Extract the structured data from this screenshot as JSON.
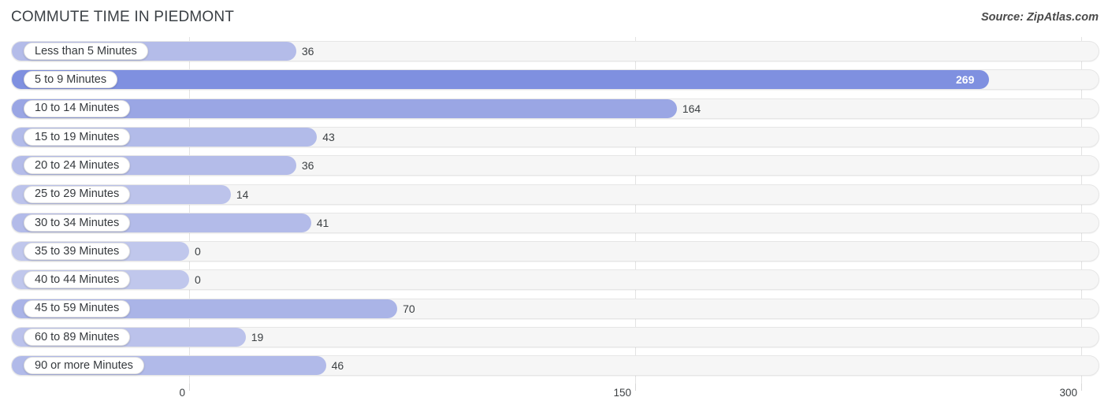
{
  "header": {
    "title": "COMMUTE TIME IN PIEDMONT",
    "source": "Source: ZipAtlas.com"
  },
  "chart_data": {
    "type": "bar",
    "orientation": "horizontal",
    "title": "COMMUTE TIME IN PIEDMONT",
    "xlabel": "",
    "ylabel": "",
    "xlim": [
      0,
      300
    ],
    "xticks": [
      0,
      150,
      300
    ],
    "xtick_labels": [
      "0",
      "150",
      "300"
    ],
    "grid": true,
    "legend": false,
    "categories": [
      "Less than 5 Minutes",
      "5 to 9 Minutes",
      "10 to 14 Minutes",
      "15 to 19 Minutes",
      "20 to 24 Minutes",
      "25 to 29 Minutes",
      "30 to 34 Minutes",
      "35 to 39 Minutes",
      "40 to 44 Minutes",
      "45 to 59 Minutes",
      "60 to 89 Minutes",
      "90 or more Minutes"
    ],
    "values": [
      36,
      269,
      164,
      43,
      36,
      14,
      41,
      0,
      0,
      70,
      19,
      46
    ],
    "value_labels": [
      "36",
      "269",
      "164",
      "43",
      "36",
      "14",
      "41",
      "0",
      "0",
      "70",
      "19",
      "46"
    ],
    "bar_colors": [
      "#b4bce9",
      "#7f90e0",
      "#9aa6e4",
      "#b2bbe9",
      "#b4bce9",
      "#bcc3eb",
      "#b3bbe9",
      "#c0c7ec",
      "#c0c7ec",
      "#aab4e7",
      "#bbc2eb",
      "#b1bae9"
    ],
    "track_color": "#f6f6f6",
    "gridline_color": "#e3e3e3"
  }
}
